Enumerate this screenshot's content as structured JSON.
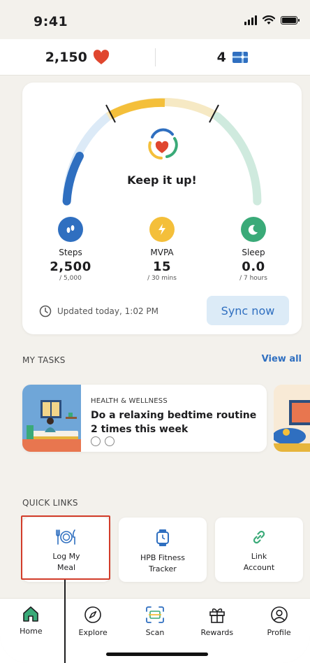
{
  "status_bar": {
    "time": "9:41"
  },
  "points_bar": {
    "points": "2,150",
    "boxes": "4"
  },
  "activity_card": {
    "message": "Keep it up!",
    "metrics": [
      {
        "label": "Steps",
        "value": "2,500",
        "goal": "/ 5,000",
        "color": "#2f6fc0",
        "icon": "shoe-icon"
      },
      {
        "label": "MVPA",
        "value": "15",
        "goal": "/ 30 mins",
        "color": "#f4bf3a",
        "icon": "lightning-icon"
      },
      {
        "label": "Sleep",
        "value": "0.0",
        "goal": "/ 7 hours",
        "color": "#3aaa78",
        "icon": "moon-icon"
      }
    ],
    "updated_text": "Updated today, 1:02 PM",
    "sync_label": "Sync now"
  },
  "tasks": {
    "section_title": "MY TASKS",
    "view_all": "View all",
    "cards": [
      {
        "category": "HEALTH & WELLNESS",
        "title": "Do a relaxing bedtime routine 2 times this week"
      }
    ]
  },
  "quick_links": {
    "section_title": "QUICK LINKS",
    "items": [
      {
        "line1": "Log My",
        "line2": "Meal",
        "icon": "plate-utensils-icon"
      },
      {
        "line1": "HPB Fitness",
        "line2": "Tracker",
        "icon": "watch-icon"
      },
      {
        "line1": "Link",
        "line2": "Account",
        "icon": "link-icon"
      }
    ]
  },
  "bottom_nav": {
    "items": [
      {
        "label": "Home",
        "icon": "home-icon",
        "active": true
      },
      {
        "label": "Explore",
        "icon": "compass-icon"
      },
      {
        "label": "Scan",
        "icon": "scan-icon"
      },
      {
        "label": "Rewards",
        "icon": "gift-icon"
      },
      {
        "label": "Profile",
        "icon": "profile-icon"
      }
    ]
  },
  "colors": {
    "primary_blue": "#2f6fc0",
    "heart_red": "#e0462e",
    "highlight_red": "#d23c2a",
    "background": "#f3f1ec"
  }
}
